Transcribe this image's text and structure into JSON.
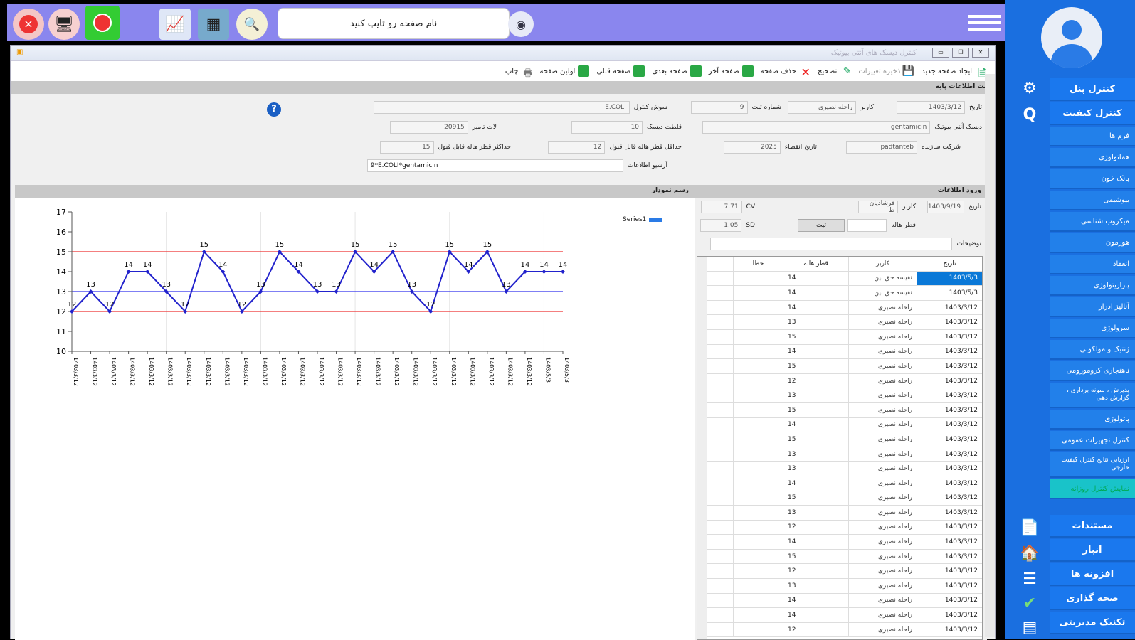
{
  "topbar": {
    "search_placeholder": "نام صفحه رو تایپ کنید",
    "search_value": ""
  },
  "sidebar": {
    "menu_top": [
      "کنترل پنل",
      "کنترل کیفیت"
    ],
    "menu_items": [
      "فرم ها",
      "هماتولوژی",
      "بانک خون",
      "بیوشیمی",
      "میکروب شناسی",
      "هورمون",
      "انعقاد",
      "پارازیتولوژی",
      "آنالیز ادرار",
      "سرولوژی",
      "ژنتیک و مولکولی",
      "ناهنجاری کروموزومی",
      "پذیرش ، نمونه برداری ، گزارش دهی",
      "پاتولوژی",
      "کنترل تجهیزات عمومی",
      "ارزیابی نتایج کنترل کیفیت خارجی",
      "نمایش کنترل روزانه"
    ],
    "menu_bottom": [
      "مستندات",
      "انبار",
      "افزونه ها",
      "صحه گذاری",
      "تکنیک مدیریتی"
    ]
  },
  "window": {
    "title": "کنترل دیسک های آنتی بیوتیک",
    "toolbar": [
      "ایجاد صفحه جدید",
      "ذخیره تغییرات",
      "تصحیح",
      "حذف صفحه",
      "صفحه آخر",
      "صفحه بعدی",
      "صفحه قبلی",
      "اولین صفحه",
      "چاپ"
    ]
  },
  "basic_info": {
    "section_title": "ثبت اطلاعات پایه",
    "date_label": "تاریخ",
    "date_value": "1403/3/12",
    "user_label": "کاربر",
    "user_value": "راحله نصیری",
    "reg_no_label": "شماره ثبت",
    "reg_no_value": "9",
    "strain_label": "سوش کنترل",
    "strain_value": "E.COLI",
    "disk_label": "دیسک آنتی بیوتیک",
    "disk_value": "gentamicin",
    "potency_label": "قلطت دیسک",
    "potency_value": "10",
    "lot_label": "لات تامیر",
    "lot_value": "20915",
    "maker_label": "شرکت سازنده",
    "maker_value": "padtanteb",
    "expiry_label": "تاریخ انقضاء",
    "expiry_value": "2025",
    "min_label": "حداقل قطر هاله قابل قبول",
    "min_value": "12",
    "max_label": "حداکثر قطر هاله قابل قبول",
    "max_value": "15",
    "archive_label": "آرشیو اطلاعات",
    "archive_value": "9*E.COLI*gentamicin"
  },
  "chart_section": {
    "title": "رسم نمودار"
  },
  "entry": {
    "section_title": "ورود اطلاعات",
    "date_label": "تاریخ",
    "date_value": "1403/9/19",
    "user_label": "کاربر",
    "user_value": "فرشادیان ط",
    "cv_label": "CV",
    "cv_value": "7.71",
    "zone_label": "قطر هاله",
    "zone_value": "",
    "save_button": "ثبت",
    "sd_label": "SD",
    "sd_value": "1.05",
    "desc_label": "توضیحات",
    "desc_value": "",
    "columns": [
      "تاریخ",
      "کاربر",
      "قطر هاله",
      "خطا"
    ],
    "rows": [
      [
        "1403/5/3",
        "نفیسه حق بین",
        "14",
        ""
      ],
      [
        "1403/5/3",
        "نفیسه حق بین",
        "14",
        ""
      ],
      [
        "1403/3/12",
        "راحله نصیری",
        "14",
        ""
      ],
      [
        "1403/3/12",
        "راحله نصیری",
        "13",
        ""
      ],
      [
        "1403/3/12",
        "راحله نصیری",
        "15",
        ""
      ],
      [
        "1403/3/12",
        "راحله نصیری",
        "14",
        ""
      ],
      [
        "1403/3/12",
        "راحله نصیری",
        "15",
        ""
      ],
      [
        "1403/3/12",
        "راحله نصیری",
        "12",
        ""
      ],
      [
        "1403/3/12",
        "راحله نصیری",
        "13",
        ""
      ],
      [
        "1403/3/12",
        "راحله نصیری",
        "15",
        ""
      ],
      [
        "1403/3/12",
        "راحله نصیری",
        "14",
        ""
      ],
      [
        "1403/3/12",
        "راحله نصیری",
        "15",
        ""
      ],
      [
        "1403/3/12",
        "راحله نصیری",
        "13",
        ""
      ],
      [
        "1403/3/12",
        "راحله نصیری",
        "13",
        ""
      ],
      [
        "1403/3/12",
        "راحله نصیری",
        "14",
        ""
      ],
      [
        "1403/3/12",
        "راحله نصیری",
        "15",
        ""
      ],
      [
        "1403/3/12",
        "راحله نصیری",
        "13",
        ""
      ],
      [
        "1403/3/12",
        "راحله نصیری",
        "12",
        ""
      ],
      [
        "1403/3/12",
        "راحله نصیری",
        "14",
        ""
      ],
      [
        "1403/3/12",
        "راحله نصیری",
        "15",
        ""
      ],
      [
        "1403/3/12",
        "راحله نصیری",
        "12",
        ""
      ],
      [
        "1403/3/12",
        "راحله نصیری",
        "13",
        ""
      ],
      [
        "1403/3/12",
        "راحله نصیری",
        "14",
        ""
      ],
      [
        "1403/3/12",
        "راحله نصیری",
        "14",
        ""
      ],
      [
        "1403/3/12",
        "راحله نصیری",
        "12",
        ""
      ]
    ]
  },
  "chart_data": {
    "type": "line",
    "series": [
      {
        "name": "Series1",
        "color": "#2222cc",
        "values": [
          12,
          13,
          12,
          14,
          14,
          13,
          12,
          15,
          14,
          12,
          13,
          15,
          14,
          13,
          13,
          15,
          14,
          15,
          13,
          12,
          15,
          14,
          15,
          13,
          14,
          14,
          14
        ]
      }
    ],
    "x": [
      "1403/3/12",
      "1403/3/12",
      "1403/3/12",
      "1403/3/12",
      "1403/3/12",
      "1403/3/12",
      "1403/3/12",
      "1403/3/12",
      "1403/3/12",
      "1403/3/12",
      "1403/3/12",
      "1403/3/12",
      "1403/3/12",
      "1403/3/12",
      "1403/3/12",
      "1403/3/12",
      "1403/3/12",
      "1403/3/12",
      "1403/3/12",
      "1403/3/12",
      "1403/3/12",
      "1403/3/12",
      "1403/3/12",
      "1403/3/12",
      "1403/3/12",
      "1403/5/3",
      "1403/5/3"
    ],
    "ylim": [
      10,
      17
    ],
    "yticks": [
      10,
      11,
      12,
      13,
      14,
      15,
      16,
      17
    ],
    "reference_lines": [
      {
        "y": 15,
        "color": "#ee3333"
      },
      {
        "y": 13,
        "color": "#3333ee"
      },
      {
        "y": 12,
        "color": "#ee3333"
      }
    ],
    "legend": "top-right"
  }
}
